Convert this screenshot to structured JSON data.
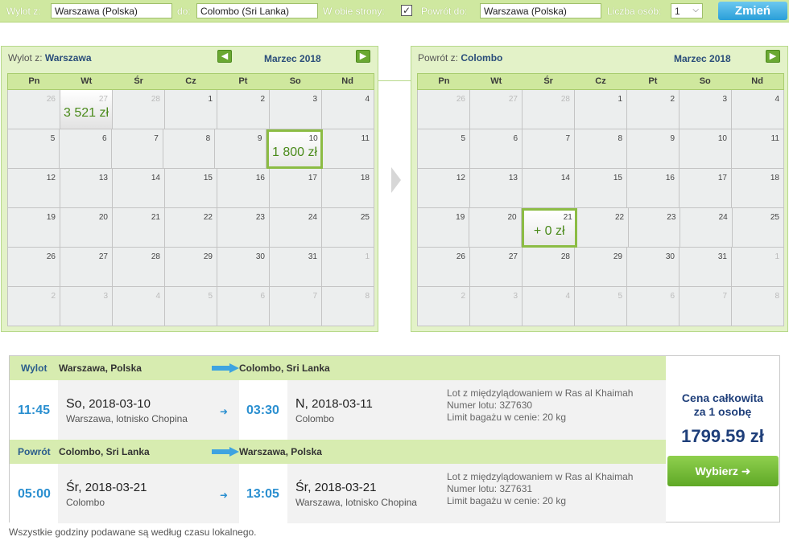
{
  "search": {
    "from_label": "Wylot z:",
    "from_value": "Warszawa (Polska)",
    "to_label": "do:",
    "to_value": "Colombo (Sri Lanka)",
    "roundtrip_label": "W obie strony:",
    "roundtrip_checked": "✓",
    "return_label": "Powrót do:",
    "return_value": "Warszawa (Polska)",
    "persons_label": "Liczba osób:",
    "persons_value": "1",
    "change_button": "Zmień"
  },
  "outbound_calendar": {
    "title_prefix": "Wylot z:",
    "title_city": "Warszawa",
    "month": "Marzec 2018",
    "weekdays": [
      "Pn",
      "Wt",
      "Śr",
      "Cz",
      "Pt",
      "So",
      "Nd"
    ],
    "weeks": [
      [
        {
          "d": "26",
          "o": true
        },
        {
          "d": "27",
          "o": true,
          "p": "3 521 zł"
        },
        {
          "d": "28",
          "o": true
        },
        {
          "d": "1"
        },
        {
          "d": "2"
        },
        {
          "d": "3"
        },
        {
          "d": "4"
        }
      ],
      [
        {
          "d": "5"
        },
        {
          "d": "6"
        },
        {
          "d": "7"
        },
        {
          "d": "8"
        },
        {
          "d": "9"
        },
        {
          "d": "10",
          "p": "1 800 zł",
          "s": true
        },
        {
          "d": "11"
        }
      ],
      [
        {
          "d": "12"
        },
        {
          "d": "13"
        },
        {
          "d": "14"
        },
        {
          "d": "15"
        },
        {
          "d": "16"
        },
        {
          "d": "17"
        },
        {
          "d": "18"
        }
      ],
      [
        {
          "d": "19"
        },
        {
          "d": "20"
        },
        {
          "d": "21"
        },
        {
          "d": "22"
        },
        {
          "d": "23"
        },
        {
          "d": "24"
        },
        {
          "d": "25"
        }
      ],
      [
        {
          "d": "26"
        },
        {
          "d": "27"
        },
        {
          "d": "28"
        },
        {
          "d": "29"
        },
        {
          "d": "30"
        },
        {
          "d": "31"
        },
        {
          "d": "1",
          "o": true
        }
      ],
      [
        {
          "d": "2",
          "o": true
        },
        {
          "d": "3",
          "o": true
        },
        {
          "d": "4",
          "o": true
        },
        {
          "d": "5",
          "o": true
        },
        {
          "d": "6",
          "o": true
        },
        {
          "d": "7",
          "o": true
        },
        {
          "d": "8",
          "o": true
        }
      ]
    ]
  },
  "return_calendar": {
    "title_prefix": "Powrót z:",
    "title_city": "Colombo",
    "month": "Marzec 2018",
    "weekdays": [
      "Pn",
      "Wt",
      "Śr",
      "Cz",
      "Pt",
      "So",
      "Nd"
    ],
    "weeks": [
      [
        {
          "d": "26",
          "o": true
        },
        {
          "d": "27",
          "o": true
        },
        {
          "d": "28",
          "o": true
        },
        {
          "d": "1"
        },
        {
          "d": "2"
        },
        {
          "d": "3"
        },
        {
          "d": "4"
        }
      ],
      [
        {
          "d": "5"
        },
        {
          "d": "6"
        },
        {
          "d": "7"
        },
        {
          "d": "8"
        },
        {
          "d": "9"
        },
        {
          "d": "10"
        },
        {
          "d": "11"
        }
      ],
      [
        {
          "d": "12"
        },
        {
          "d": "13"
        },
        {
          "d": "14"
        },
        {
          "d": "15"
        },
        {
          "d": "16"
        },
        {
          "d": "17"
        },
        {
          "d": "18"
        }
      ],
      [
        {
          "d": "19"
        },
        {
          "d": "20"
        },
        {
          "d": "21",
          "p": "+ 0 zł",
          "s": true
        },
        {
          "d": "22"
        },
        {
          "d": "23"
        },
        {
          "d": "24"
        },
        {
          "d": "25"
        }
      ],
      [
        {
          "d": "26"
        },
        {
          "d": "27"
        },
        {
          "d": "28"
        },
        {
          "d": "29"
        },
        {
          "d": "30"
        },
        {
          "d": "31"
        },
        {
          "d": "1",
          "o": true
        }
      ],
      [
        {
          "d": "2",
          "o": true
        },
        {
          "d": "3",
          "o": true
        },
        {
          "d": "4",
          "o": true
        },
        {
          "d": "5",
          "o": true
        },
        {
          "d": "6",
          "o": true
        },
        {
          "d": "7",
          "o": true
        },
        {
          "d": "8",
          "o": true
        }
      ]
    ]
  },
  "outbound": {
    "label": "Wylot",
    "from": "Warszawa, Polska",
    "to": "Colombo, Sri Lanka",
    "dep_time": "11:45",
    "dep_day": "So,",
    "dep_date": "2018-03-10",
    "dep_place": "Warszawa, lotnisko Chopina",
    "arr_time": "03:30",
    "arr_day": "N,",
    "arr_date": "2018-03-11",
    "arr_place": "Colombo",
    "info1": "Lot z międzylądowaniem w Ras al Khaimah",
    "info2": "Numer lotu: 3Z7630",
    "info3": "Limit bagażu w cenie: 20 kg"
  },
  "inbound": {
    "label": "Powrót",
    "from": "Colombo, Sri Lanka",
    "to": "Warszawa, Polska",
    "dep_time": "05:00",
    "dep_day": "Śr,",
    "dep_date": "2018-03-21",
    "dep_place": "Colombo",
    "arr_time": "13:05",
    "arr_day": "Śr,",
    "arr_date": "2018-03-21",
    "arr_place": "Warszawa, lotnisko Chopina",
    "info1": "Lot z międzylądowaniem w Ras al Khaimah",
    "info2": "Numer lotu: 3Z7631",
    "info3": "Limit bagażu w cenie: 20 kg"
  },
  "price": {
    "caption1": "Cena całkowita",
    "caption2": "za 1 osobę",
    "total": "1799.59 zł",
    "choose_button": "Wybierz",
    "choose_icon": "arrow-right-icon"
  },
  "footer_note": "Wszystkie godziny podawane są według czasu lokalnego.",
  "colors": {
    "accent_green": "#8cbc44",
    "time_blue": "#2a8fd0",
    "price_navy": "#1f3f7a",
    "button_blue": "#2a9fd8"
  }
}
